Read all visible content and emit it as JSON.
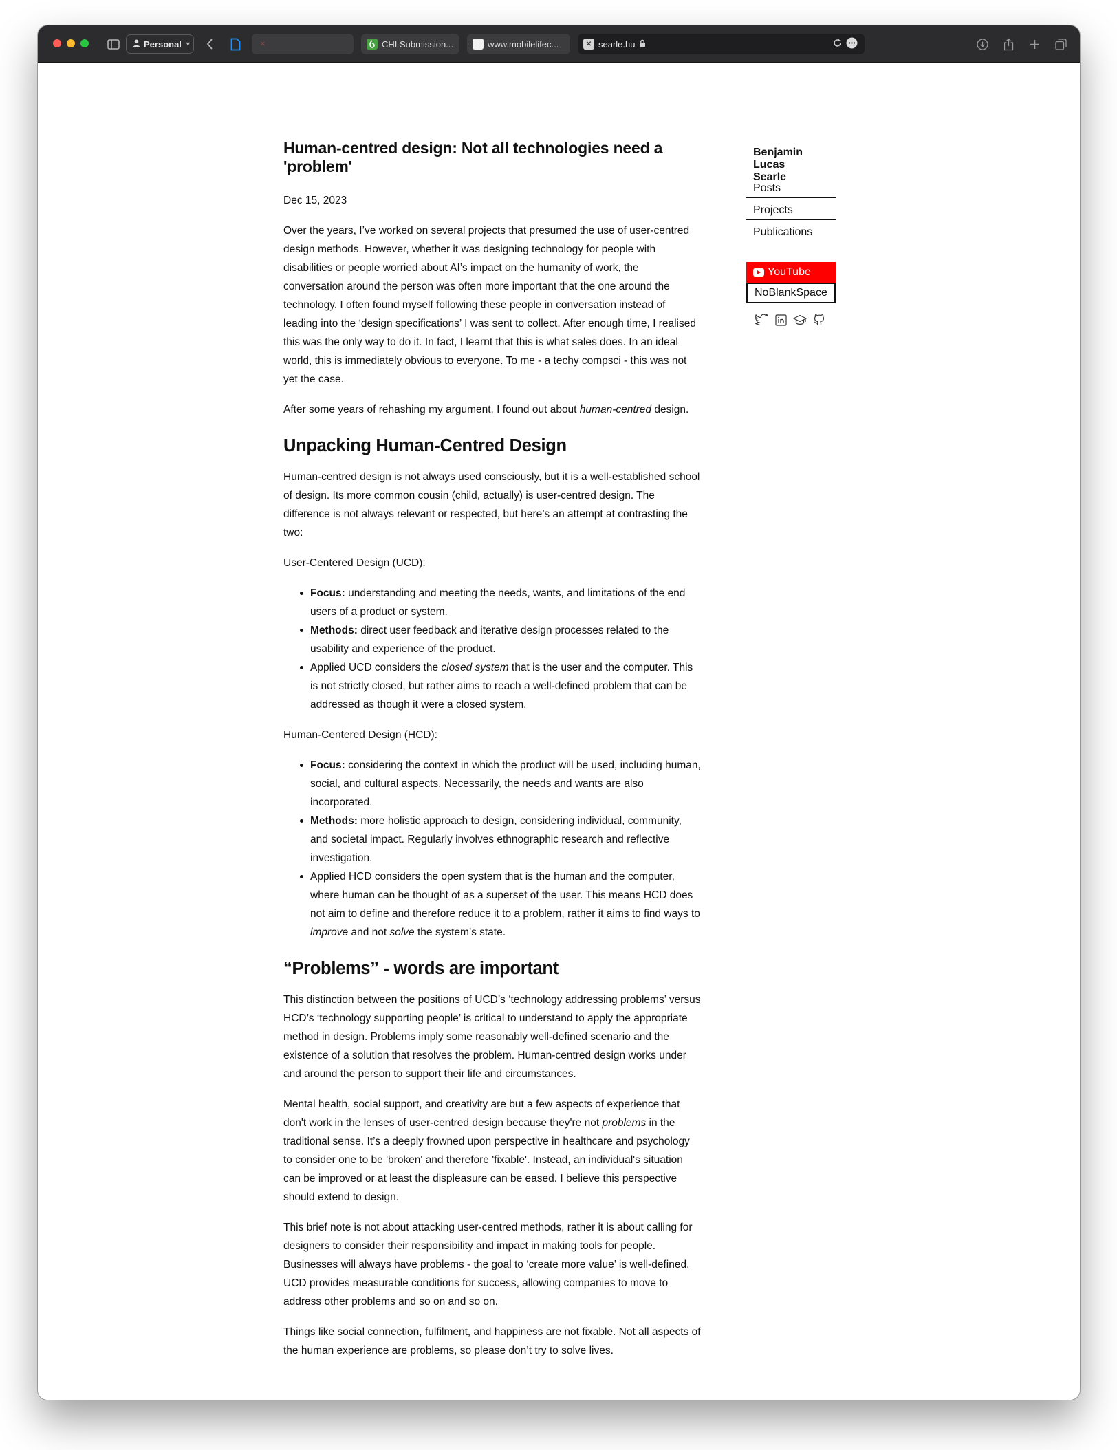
{
  "browser": {
    "profile_label": "Personal",
    "tabs": [
      {
        "title": "",
        "favicon": "empty-tab"
      },
      {
        "title": "CHI Submission...",
        "favicon": "overleaf-icon"
      },
      {
        "title": "www.mobilelifec...",
        "favicon": "blank-page-icon"
      },
      {
        "title": "searle.hu",
        "favicon": "close-tab-icon"
      }
    ]
  },
  "article": {
    "title": "Human-centred design: Not all technologies need a 'problem'",
    "date": "Dec 15, 2023",
    "p1": "Over the years, I’ve worked on several projects that presumed the use of user-centred design methods. However, whether it was designing technology for people with disabilities or people worried about AI’s impact on the humanity of work, the conversation around the person was often more important that the one around the technology. I often found myself following these people in conversation instead of leading into the ‘design specifications’ I was sent to collect. After enough time, I realised this was the only way to do it. In fact, I learnt that this is what sales does. In an ideal world, this is immediately obvious to everyone. To me - a techy compsci - this was not yet the case.",
    "p2_before": "After some years of rehashing my argument, I found out about ",
    "p2_em": "human-centred",
    "p2_after": " design.",
    "h2_1": "Unpacking Human-Centred Design",
    "p3": "Human-centred design is not always used consciously, but it is a well-established school of design. Its more common cousin (child, actually) is user-centred design. The difference is not always relevant or respected, but here’s an attempt at contrasting the two:",
    "ucd_heading": "User-Centered Design (UCD):",
    "ucd": {
      "focus_label": "Focus:",
      "focus_text": " understanding and meeting the needs, wants, and limitations of the end users of a product or system.",
      "methods_label": "Methods:",
      "methods_text": " direct user feedback and iterative design processes related to the usability and experience of the product.",
      "applied_before": "Applied UCD considers the ",
      "applied_em": "closed system",
      "applied_after": " that is the user and the computer. This is not strictly closed, but rather aims to reach a well-defined problem that can be addressed as though it were a closed system."
    },
    "hcd_heading": "Human-Centered Design (HCD):",
    "hcd": {
      "focus_label": "Focus:",
      "focus_text": " considering the context in which the product will be used, including human, social, and cultural aspects. Necessarily, the needs and wants are also incorporated.",
      "methods_label": "Methods:",
      "methods_text": " more holistic approach to design, considering individual, community, and societal impact. Regularly involves ethnographic research and reflective investigation.",
      "applied_before": "Applied HCD considers the open system that is the human and the computer, where human can be thought of as a superset of the user. This means HCD does not aim to define and therefore reduce it to a problem, rather it aims to find ways to ",
      "applied_em1": "improve",
      "applied_mid": " and not ",
      "applied_em2": "solve",
      "applied_after": " the system’s state."
    },
    "h2_2": "“Problems” - words are important",
    "p4": "This distinction between the positions of UCD’s ‘technology addressing problems’ versus HCD’s ‘technology supporting people’ is critical to understand to apply the appropriate method in design. Problems imply some reasonably well-defined scenario and the existence of a solution that resolves the problem. Human-centred design works under and around the person to support their life and circumstances.",
    "p5_before": "Mental health, social support, and creativity are but a few aspects of experience that don't work in the lenses of user-centred design because they're not ",
    "p5_em": "problems",
    "p5_after": " in the traditional sense. It’s a deeply frowned upon perspective in healthcare and psychology to consider one to be 'broken' and therefore 'fixable'. Instead, an individual's situation can be improved or at least the displeasure can be eased. I believe this perspective should extend to design.",
    "p6": "This brief note is not about attacking user-centred methods, rather it is about calling for designers to consider their responsibility and impact in making tools for people. Businesses will always have problems - the goal to ‘create more value’ is well-defined. UCD provides measurable conditions for success, allowing companies to move to address other problems and so on and so on.",
    "p7": "Things like social connection, fulfilment, and happiness are not fixable. Not all aspects of the human experience are problems, so please don’t try to solve lives."
  },
  "sidebar": {
    "name_line1": "Benjamin",
    "name_line2": "Lucas",
    "name_line3": "Searle",
    "nav": [
      "Posts",
      "Projects",
      "Publications"
    ],
    "youtube_label": "YouTube",
    "nbs_label": "NoBlankSpace",
    "social_icons": [
      "twitter-icon",
      "linkedin-icon",
      "scholar-icon",
      "github-icon"
    ]
  },
  "colors": {
    "youtube": "#ff0000",
    "toolbar": "#2c2c2e"
  }
}
